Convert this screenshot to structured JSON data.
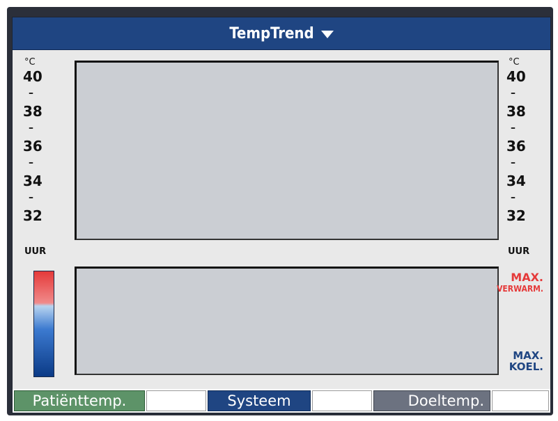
{
  "header": {
    "title": "TempTrend",
    "caret_icon": "caret-down"
  },
  "temperature_axis": {
    "unit": "°C",
    "ticks": [
      "40",
      "38",
      "36",
      "34",
      "32"
    ],
    "minor_tick": "–"
  },
  "time_axis": {
    "label": "UUR"
  },
  "heating_cooling": {
    "max_heat": {
      "line1": "MAX.",
      "line2": "VERWARM.",
      "color": "#e53a3a"
    },
    "max_cool": {
      "line1": "MAX.",
      "line2": "KOEL.",
      "color": "#1f4582"
    }
  },
  "tabs": [
    {
      "label": "Patiënttemp.",
      "color": "#5d9368"
    },
    {
      "label": "",
      "color": "#ffffff"
    },
    {
      "label": "Systeem",
      "color": "#1f4582"
    },
    {
      "label": "",
      "color": "#ffffff"
    },
    {
      "label": "Doeltemp.",
      "color": "#6c7280"
    },
    {
      "label": "",
      "color": "#ffffff"
    }
  ]
}
